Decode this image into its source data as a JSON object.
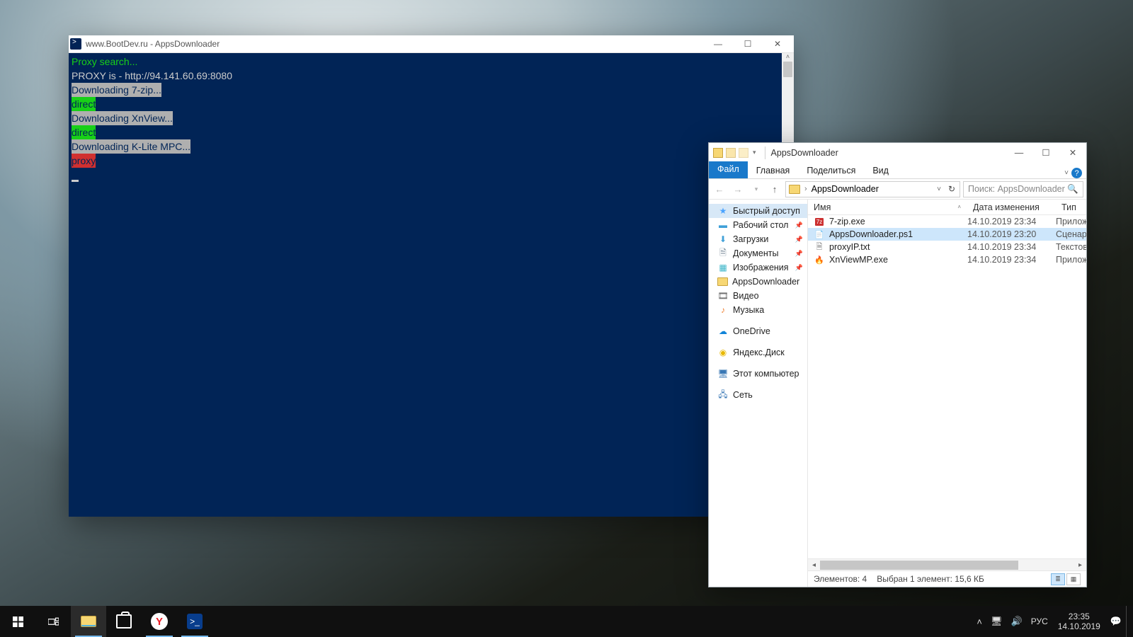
{
  "powershell": {
    "title": "www.BootDev.ru - AppsDownloader",
    "lines": [
      {
        "text": "Proxy search...",
        "cls": "ps-fg-green"
      },
      {
        "text": "PROXY is - http://94.141.60.69:8080",
        "cls": ""
      },
      {
        "text": "",
        "cls": ""
      },
      {
        "text": "Downloading 7-zip...",
        "cls": "hl-gray"
      },
      {
        "text": "direct",
        "cls": "hl-green"
      },
      {
        "text": "Downloading XnView...",
        "cls": "hl-gray"
      },
      {
        "text": "direct",
        "cls": "hl-green"
      },
      {
        "text": "Downloading K-Lite MPC...",
        "cls": "hl-gray"
      },
      {
        "text": "proxy",
        "cls": "hl-red"
      }
    ]
  },
  "explorer": {
    "title": "AppsDownloader",
    "tabs": {
      "file": "Файл",
      "home": "Главная",
      "share": "Поделиться",
      "view": "Вид"
    },
    "address": {
      "folder": "AppsDownloader"
    },
    "search": {
      "placeholder": "Поиск: AppsDownloader"
    },
    "sidebar": {
      "quick": "Быстрый доступ",
      "desktop": "Рабочий стол",
      "downloads": "Загрузки",
      "documents": "Документы",
      "pictures": "Изображения",
      "apps": "AppsDownloader",
      "video": "Видео",
      "music": "Музыка",
      "onedrive": "OneDrive",
      "yandex": "Яндекс.Диск",
      "thispc": "Этот компьютер",
      "network": "Сеть"
    },
    "columns": {
      "name": "Имя",
      "date": "Дата изменения",
      "type": "Тип"
    },
    "files": [
      {
        "name": "7-zip.exe",
        "date": "14.10.2019 23:34",
        "type": "Приложе",
        "icon": "7z"
      },
      {
        "name": "AppsDownloader.ps1",
        "date": "14.10.2019 23:20",
        "type": "Сценарий",
        "icon": "ps1",
        "selected": true
      },
      {
        "name": "proxyIP.txt",
        "date": "14.10.2019 23:34",
        "type": "Текстовы",
        "icon": "txt"
      },
      {
        "name": "XnViewMP.exe",
        "date": "14.10.2019 23:34",
        "type": "Приложе",
        "icon": "xn"
      }
    ],
    "status": {
      "items": "Элементов: 4",
      "selected": "Выбран 1 элемент: 15,6 КБ"
    }
  },
  "taskbar": {
    "lang": "РУС",
    "time": "23:35",
    "date": "14.10.2019"
  }
}
